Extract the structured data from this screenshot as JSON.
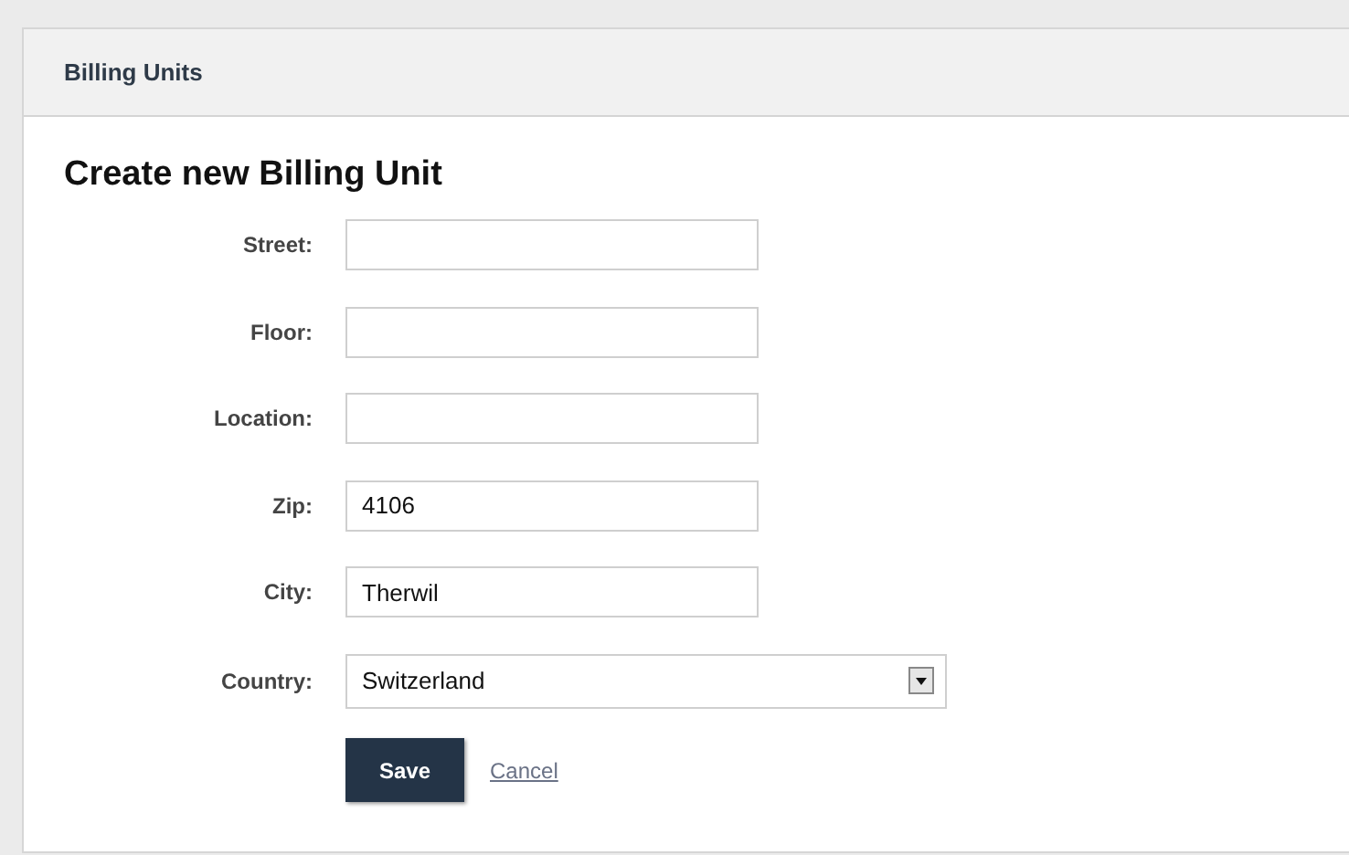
{
  "panel": {
    "title": "Billing Units"
  },
  "form": {
    "heading": "Create new Billing Unit",
    "fields": [
      {
        "kind": "text",
        "label": "Street:"
      },
      {
        "kind": "text",
        "label": "Floor:"
      },
      {
        "kind": "text",
        "label": "Location:"
      },
      {
        "kind": "text",
        "label": "Zip:",
        "value": "4106"
      },
      {
        "kind": "text",
        "label": "City:",
        "value": "Therwil"
      },
      {
        "kind": "select",
        "label": "Country:",
        "value": "Switzerland"
      }
    ],
    "save_button": "Save",
    "cancel_link": "Cancel"
  }
}
